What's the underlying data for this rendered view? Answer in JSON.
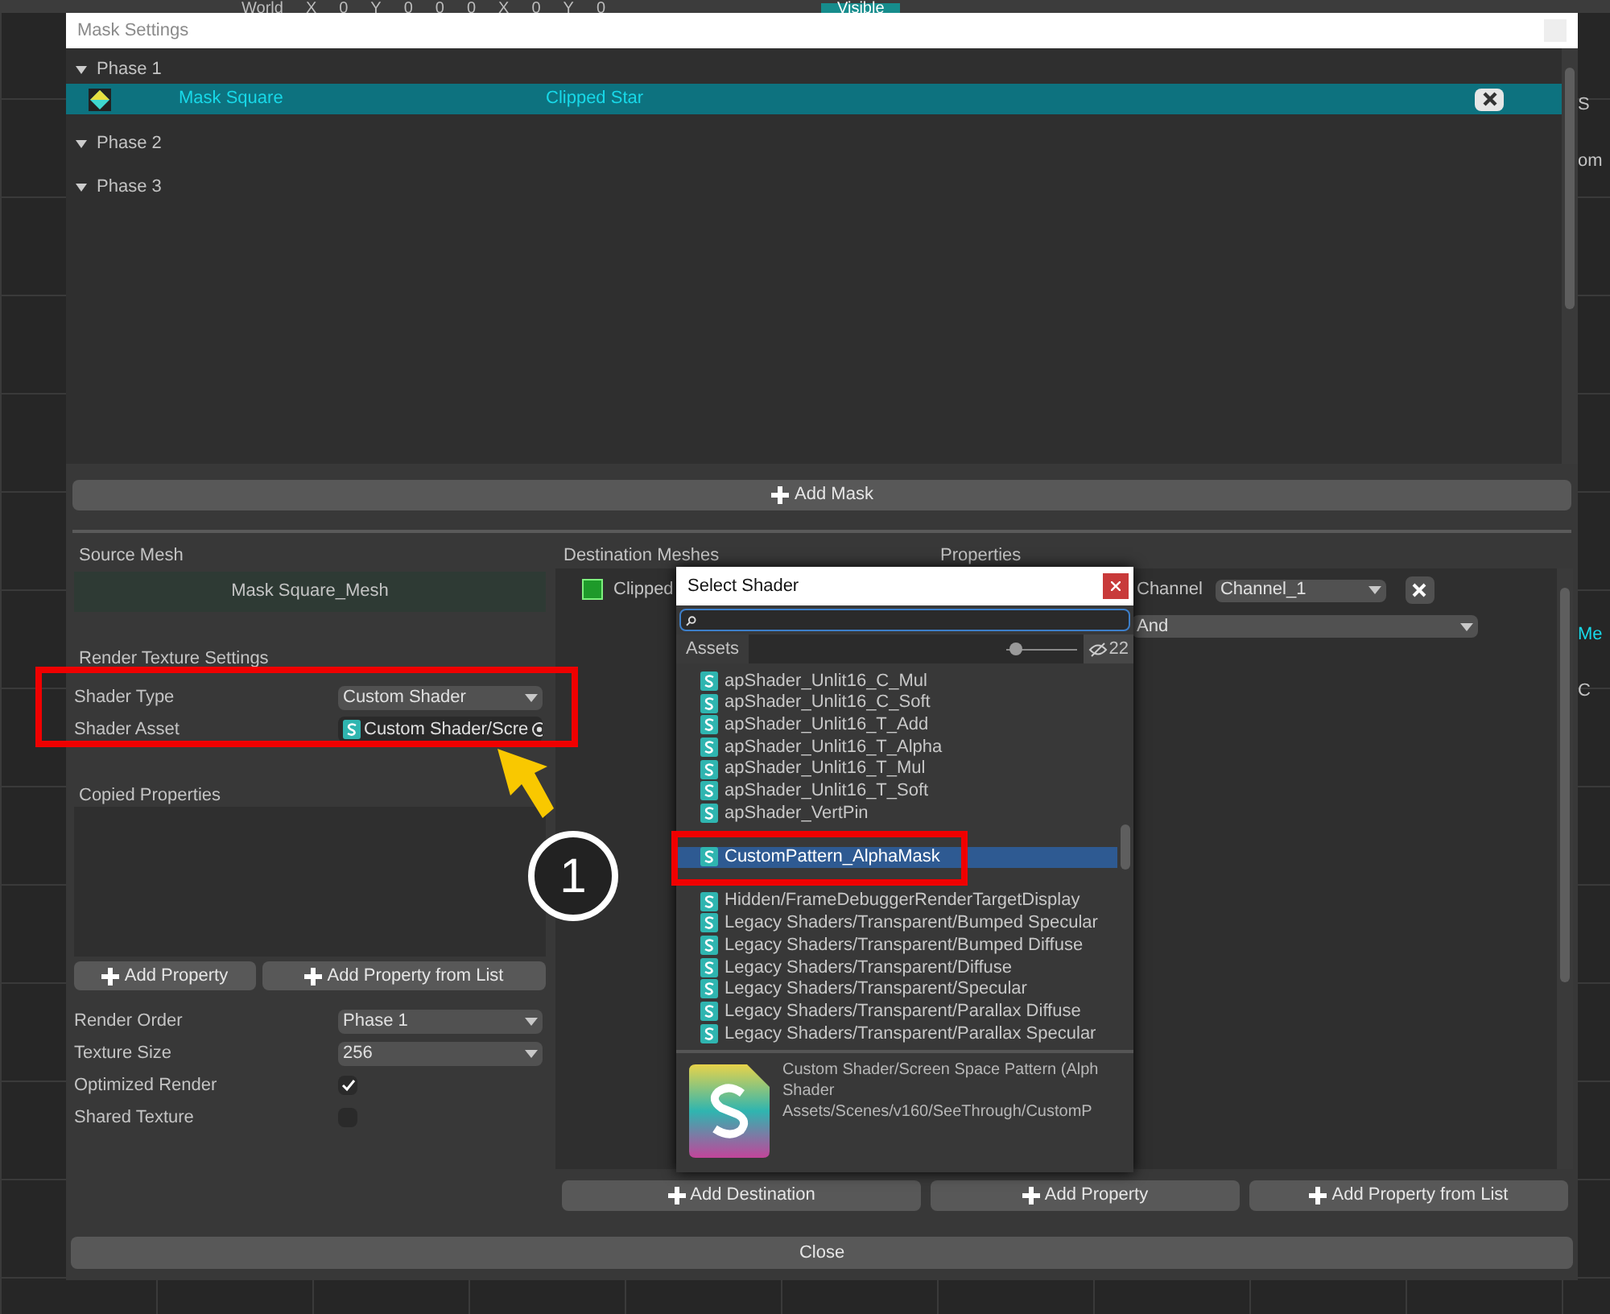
{
  "editor_toolbar": [
    "World",
    "X",
    "0",
    "Y",
    "0",
    "0",
    "0",
    "X",
    "0",
    "Y",
    "0"
  ],
  "editor_visible": "Visible",
  "side_panel": [
    "S",
    "om",
    "Me",
    "C"
  ],
  "window": {
    "title": "Mask Settings"
  },
  "phases": [
    {
      "label": "Phase 1",
      "expanded": true,
      "masks": [
        {
          "source": "Mask Square",
          "destination": "Clipped Star",
          "selected": true
        }
      ]
    },
    {
      "label": "Phase 2",
      "expanded": true
    },
    {
      "label": "Phase 3",
      "expanded": true
    }
  ],
  "add_mask": "Add Mask",
  "source": {
    "heading": "Source Mesh",
    "mesh": "Mask Square_Mesh",
    "section": "Render Texture Settings",
    "fields": [
      {
        "label": "Shader Type",
        "kind": "dropdown",
        "value": "Custom Shader"
      },
      {
        "label": "Shader Asset",
        "kind": "object",
        "value": "Custom Shader/Scre"
      }
    ],
    "copied_heading": "Copied Properties",
    "buttons": [
      "Add Property",
      "Add Property from List"
    ],
    "settings": [
      {
        "label": "Render Order",
        "kind": "dropdown",
        "value": "Phase 1"
      },
      {
        "label": "Texture Size",
        "kind": "dropdown",
        "value": "256"
      },
      {
        "label": "Optimized Render",
        "kind": "checkbox",
        "checked": true
      },
      {
        "label": "Shared Texture",
        "kind": "checkbox",
        "checked": false
      }
    ]
  },
  "destination": {
    "heading": "Destination Meshes",
    "items": [
      {
        "name": "Clipped"
      }
    ],
    "button": "Add Destination"
  },
  "properties": {
    "heading": "Properties",
    "channel_label": "Channel",
    "channel": "Channel_1",
    "operator": "And",
    "buttons": [
      "Add Property",
      "Add Property from List"
    ]
  },
  "close": "Close",
  "popup": {
    "title": "Select Shader",
    "tab": "Assets",
    "zoom": {
      "level": 0.05
    },
    "hidden_count": "22",
    "items": [
      {
        "name": "apShader_Unlit16_C_Mul",
        "selected": false
      },
      {
        "name": "apShader_Unlit16_C_Soft",
        "selected": false
      },
      {
        "name": "apShader_Unlit16_T_Add",
        "selected": false
      },
      {
        "name": "apShader_Unlit16_T_Alpha",
        "selected": false
      },
      {
        "name": "apShader_Unlit16_T_Mul",
        "selected": false
      },
      {
        "name": "apShader_Unlit16_T_Soft",
        "selected": false
      },
      {
        "name": "apShader_VertPin",
        "selected": false
      },
      {
        "name": "CustomPattern_AlphaMask",
        "selected": true
      },
      {
        "name": "Hidden/FrameDebuggerRenderTargetDisplay",
        "selected": false
      },
      {
        "name": "Legacy Shaders/Transparent/Bumped Specular",
        "selected": false
      },
      {
        "name": "Legacy Shaders/Transparent/Bumped Diffuse",
        "selected": false
      },
      {
        "name": "Legacy Shaders/Transparent/Diffuse",
        "selected": false
      },
      {
        "name": "Legacy Shaders/Transparent/Specular",
        "selected": false
      },
      {
        "name": "Legacy Shaders/Transparent/Parallax Diffuse",
        "selected": false
      },
      {
        "name": "Legacy Shaders/Transparent/Parallax Specular",
        "selected": false
      }
    ],
    "preview": [
      "Custom Shader/Screen Space Pattern (Alph",
      "Shader",
      "Assets/Scenes/v160/SeeThrough/CustomP"
    ]
  },
  "callout": {
    "number": "1"
  }
}
